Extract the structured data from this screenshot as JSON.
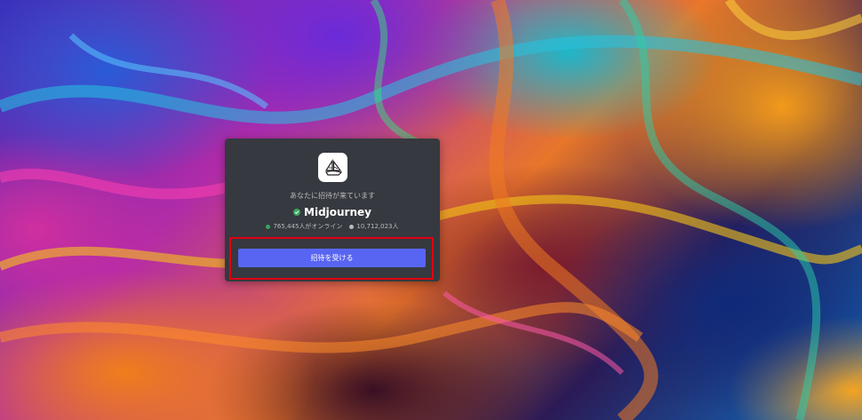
{
  "invite": {
    "subtitle": "あなたに招待が来ています",
    "server_name": "Midjourney",
    "online_count": "765,445人がオンライン",
    "member_count": "10,712,023人",
    "accept_label": "招待を受ける"
  },
  "icons": {
    "server": "sailboat-icon",
    "verified": "verified-check-icon"
  },
  "colors": {
    "card_bg": "#36393f",
    "button_bg": "#5865f2",
    "online_dot": "#3ba55d",
    "highlight_border": "#e00012"
  }
}
